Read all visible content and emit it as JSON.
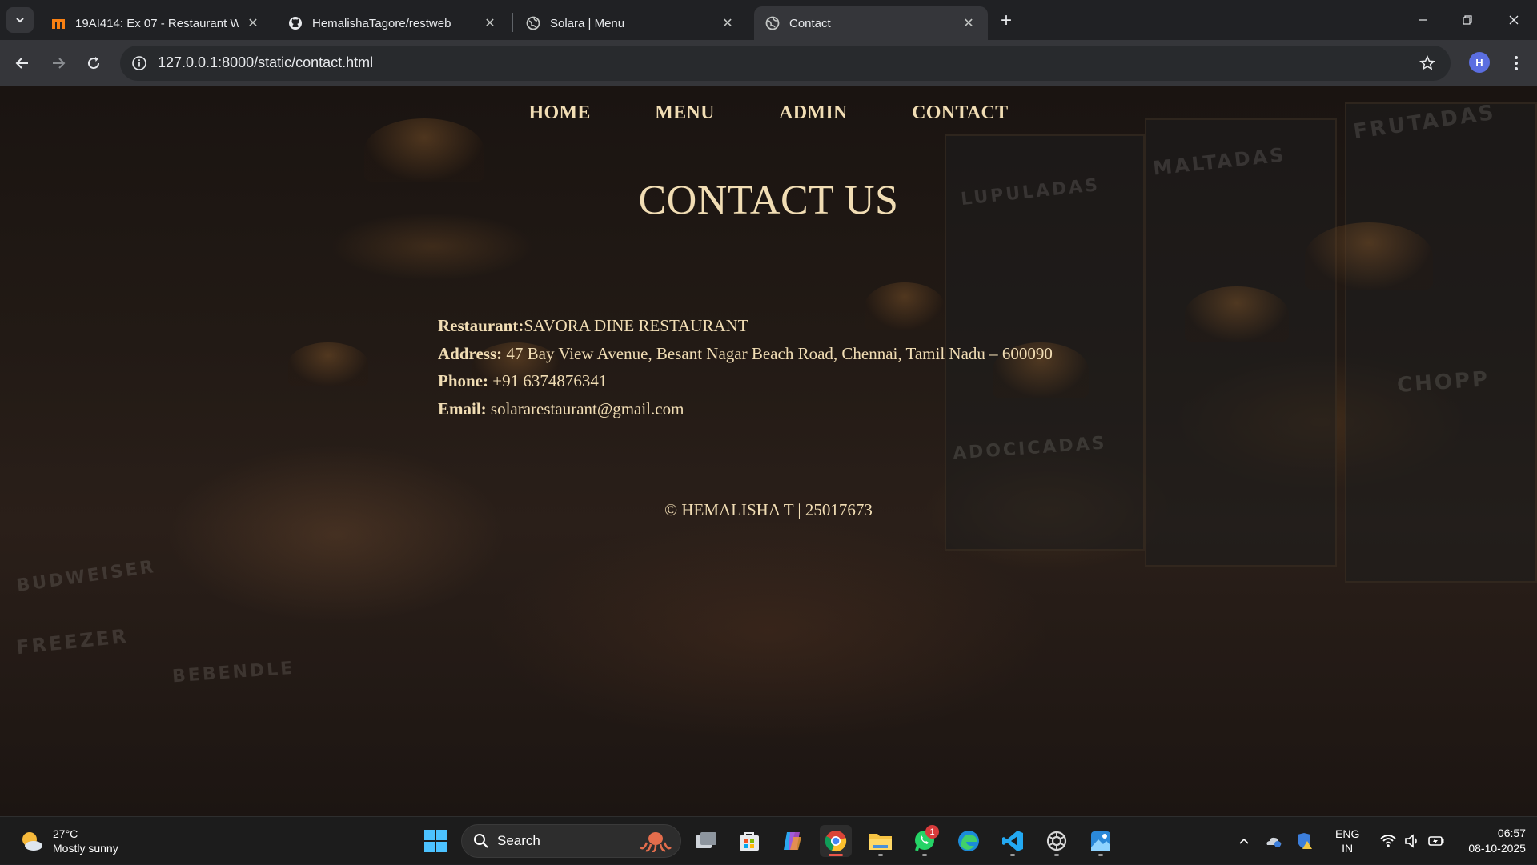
{
  "browser": {
    "tabs": [
      {
        "title": "19AI414: Ex 07 - Restaurant We",
        "favicon": "moodle-icon",
        "active": false
      },
      {
        "title": "HemalishaTagore/restweb",
        "favicon": "github-icon",
        "active": false
      },
      {
        "title": "Solara | Menu",
        "favicon": "globe-icon",
        "active": false
      },
      {
        "title": "Contact",
        "favicon": "globe-icon",
        "active": true
      }
    ],
    "url": "127.0.0.1:8000/static/contact.html",
    "profile_initial": "H"
  },
  "site": {
    "nav": {
      "home": "HOME",
      "menu": "MENU",
      "admin": "ADMIN",
      "contact": "CONTACT"
    },
    "title": "CONTACT US",
    "contact": {
      "restaurant_label": "Restaurant:",
      "restaurant_value": "SAVORA DINE RESTAURANT",
      "address_label": "Address:",
      "address_value": " 47 Bay View Avenue, Besant Nagar Beach Road, Chennai, Tamil Nadu – 600090",
      "phone_label": "Phone:",
      "phone_value": " +91 6374876341",
      "email_label": "Email:",
      "email_value": " solararestaurant@gmail.com"
    },
    "footer": "© HEMALISHA T | 25017673",
    "text_color": "#f1ddb4"
  },
  "taskbar": {
    "weather_temp": "27°C",
    "weather_condition": "Mostly sunny",
    "search_label": "Search",
    "whatsapp_badge": "1",
    "language_top": "ENG",
    "language_bottom": "IN",
    "time": "06:57",
    "date": "08-10-2025"
  }
}
